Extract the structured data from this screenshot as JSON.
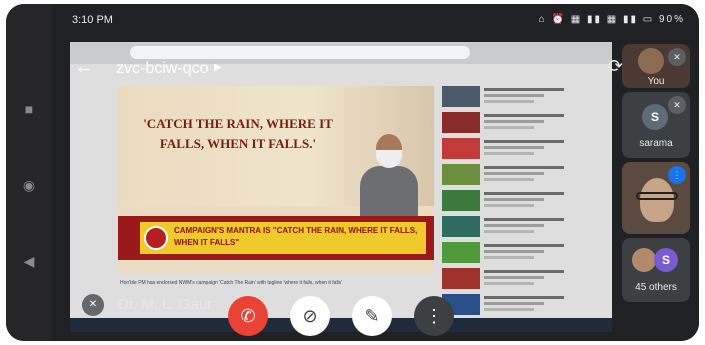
{
  "status_bar": {
    "time": "3:10 PM",
    "icons": "⌂ ⏰ ▦ ▮▮ ▦ ▮▮ ▭",
    "battery": "90%"
  },
  "meeting": {
    "code": "zvc-bciw-qco",
    "presenter_name": "Dr. M. L. Gaur"
  },
  "shared_screen": {
    "poster_quote": "'CATCH THE RAIN, WHERE IT FALLS, WHEN IT FALLS.'",
    "mantra_text": "CAMPAIGN'S MANTRA IS \"CATCH THE RAIN, WHERE IT FALLS, WHEN IT FALLS\"",
    "caption": "Hon'ble PM has endorsed NWM's campaign 'Catch The Rain' with tagline 'where it falls, when it falls'"
  },
  "participants": [
    {
      "label": "You",
      "type": "video"
    },
    {
      "label": "sarama",
      "initial": "S",
      "avatar_color": "#5f6b7a"
    },
    {
      "label": "",
      "type": "video"
    },
    {
      "label": "45 others",
      "initial": "S",
      "avatar_color": "#7b5bd1"
    }
  ],
  "controls": {
    "end_call": "✆",
    "camera": "⊘",
    "mic": "✎",
    "more": "⋮"
  },
  "colors": {
    "end_call": "#ea4335",
    "background": "#202124",
    "accent": "#1a73e8"
  }
}
